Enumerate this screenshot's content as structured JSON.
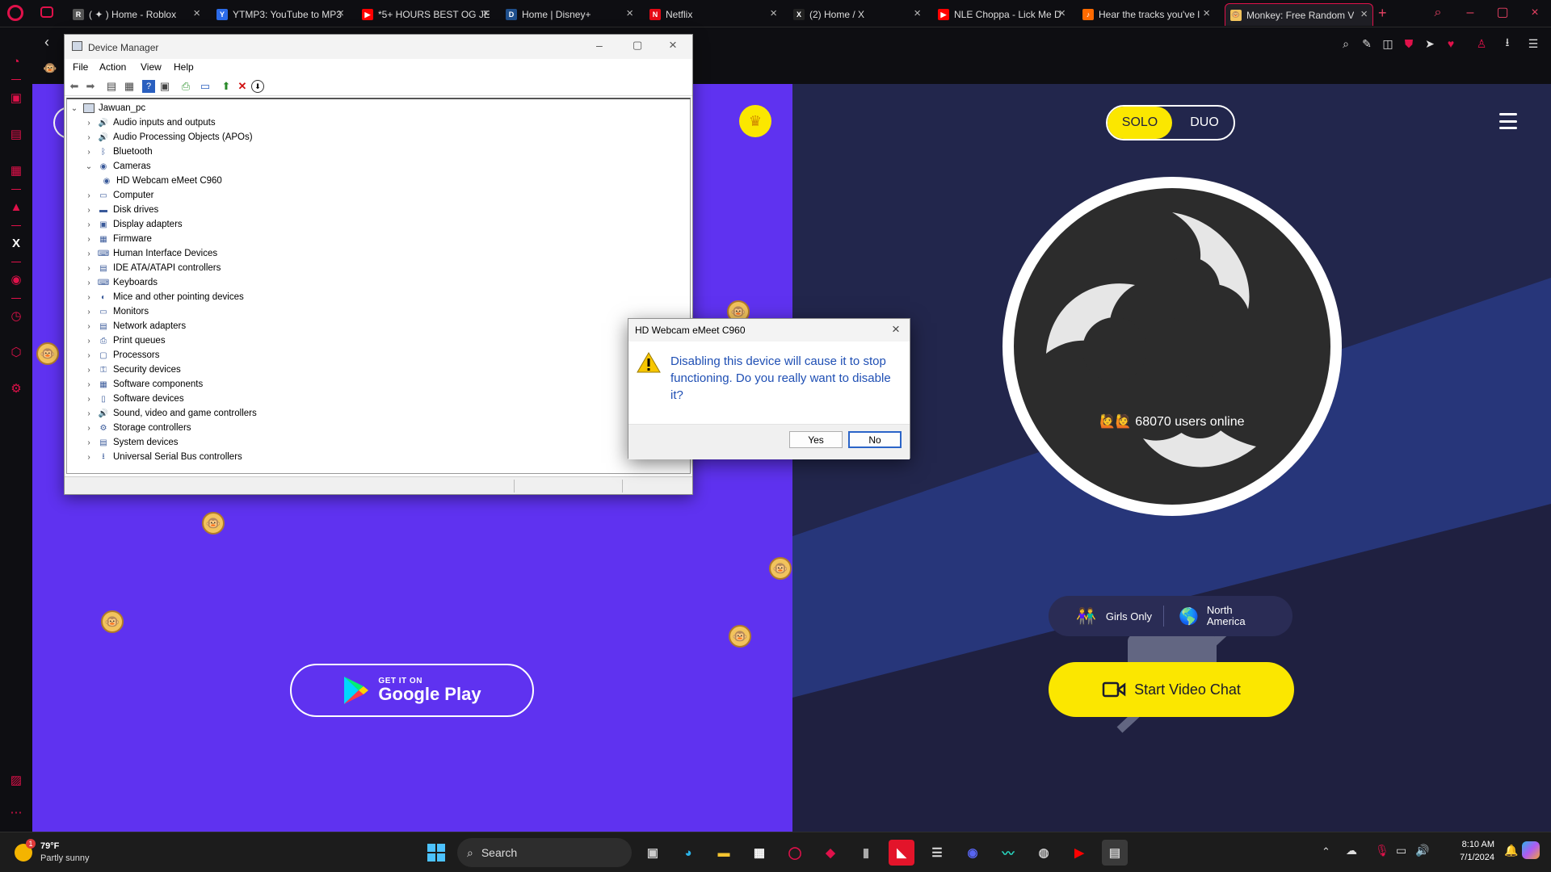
{
  "browser": {
    "tabs": [
      {
        "label": "( ✦ ) Home - Roblox",
        "color": "#555555",
        "fav": "R"
      },
      {
        "label": "YTMP3: YouTube to MP3",
        "color": "#2b6be8",
        "fav": "Y"
      },
      {
        "label": "*5+ HOURS BEST OG JE",
        "color": "#ff0000",
        "fav": "▶"
      },
      {
        "label": "Home | Disney+",
        "color": "#1f4f8c",
        "fav": "D"
      },
      {
        "label": "Netflix",
        "color": "#e50914",
        "fav": "N"
      },
      {
        "label": "(2) Home / X",
        "color": "#222222",
        "fav": "X"
      },
      {
        "label": "NLE Choppa - Lick Me D",
        "color": "#ff0000",
        "fav": "▶"
      },
      {
        "label": "Hear the tracks you've l",
        "color": "#ff6a00",
        "fav": "♪"
      },
      {
        "label": "Monkey: Free Random V",
        "color": "#f2c35d",
        "fav": "🐵"
      }
    ],
    "new_tab": "+",
    "close_glyph": "×"
  },
  "left_page": {
    "store_badge_small": "GET IT ON",
    "store_badge_big": "Google Play"
  },
  "right_page": {
    "mode_solo": "SOLO",
    "mode_duo": "DUO",
    "online_text": "🙋🙋 68070 users online",
    "filter_gender": "Girls Only",
    "filter_region_line1": "North",
    "filter_region_line2": "America",
    "start_button": "Start Video Chat"
  },
  "device_manager": {
    "title": "Device Manager",
    "menu": [
      "File",
      "Action",
      "View",
      "Help"
    ],
    "root": "Jawuan_pc",
    "categories": [
      {
        "label": "Audio inputs and outputs",
        "icon": "🔊"
      },
      {
        "label": "Audio Processing Objects (APOs)",
        "icon": "🔊"
      },
      {
        "label": "Bluetooth",
        "icon": "ᛒ"
      },
      {
        "label": "Cameras",
        "icon": "◉",
        "expanded": true
      },
      {
        "label": "HD Webcam eMeet C960",
        "icon": "◉",
        "child": true
      },
      {
        "label": "Computer",
        "icon": "▭"
      },
      {
        "label": "Disk drives",
        "icon": "▬"
      },
      {
        "label": "Display adapters",
        "icon": "▣"
      },
      {
        "label": "Firmware",
        "icon": "▦"
      },
      {
        "label": "Human Interface Devices",
        "icon": "⌨"
      },
      {
        "label": "IDE ATA/ATAPI controllers",
        "icon": "▤"
      },
      {
        "label": "Keyboards",
        "icon": "⌨"
      },
      {
        "label": "Mice and other pointing devices",
        "icon": "◐"
      },
      {
        "label": "Monitors",
        "icon": "▭"
      },
      {
        "label": "Network adapters",
        "icon": "▤"
      },
      {
        "label": "Print queues",
        "icon": "⎙"
      },
      {
        "label": "Processors",
        "icon": "▢"
      },
      {
        "label": "Security devices",
        "icon": "⚿"
      },
      {
        "label": "Software components",
        "icon": "▦"
      },
      {
        "label": "Software devices",
        "icon": "▯"
      },
      {
        "label": "Sound, video and game controllers",
        "icon": "🔊"
      },
      {
        "label": "Storage controllers",
        "icon": "⚙"
      },
      {
        "label": "System devices",
        "icon": "▤"
      },
      {
        "label": "Universal Serial Bus controllers",
        "icon": "⭳"
      }
    ]
  },
  "dialog": {
    "title": "HD Webcam eMeet C960",
    "message": "Disabling this device will cause it to stop functioning. Do you really want to disable it?",
    "yes": "Yes",
    "no": "No"
  },
  "taskbar": {
    "weather_temp": "79°F",
    "weather_desc": "Partly sunny",
    "weather_badge": "1",
    "search_placeholder": "Search",
    "time": "8:10 AM",
    "date": "7/1/2024"
  },
  "colors": {
    "opera_red": "#e0114a",
    "monkey_purple": "#5f32f0",
    "monkey_navy": "#1f2040",
    "monkey_yellow": "#fbe700",
    "dialog_text": "#1f4fb4"
  }
}
